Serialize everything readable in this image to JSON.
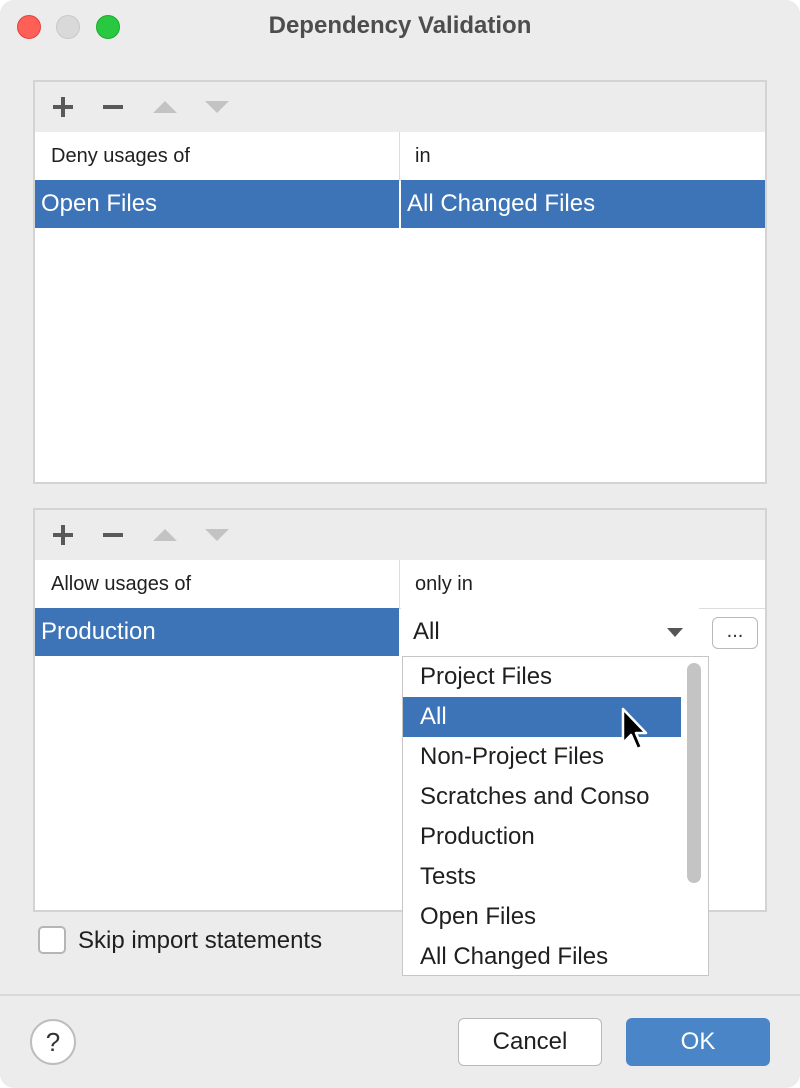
{
  "window": {
    "title": "Dependency Validation"
  },
  "deny_table": {
    "columns": [
      "Deny usages of",
      "in"
    ],
    "rows": [
      {
        "scope": "Open Files",
        "in": "All Changed Files"
      }
    ]
  },
  "allow_table": {
    "columns": [
      "Allow usages of",
      "only in"
    ],
    "rows": [
      {
        "scope": "Production",
        "only_in": "All"
      }
    ],
    "browse_label": "..."
  },
  "dropdown": {
    "options": [
      "Project Files",
      "All",
      "Non-Project Files",
      "Scratches and Conso",
      "Production",
      "Tests",
      "Open Files",
      "All Changed Files"
    ],
    "selected": "All"
  },
  "options": {
    "skip_imports_label": "Skip import statements",
    "skip_imports_checked": false
  },
  "footer": {
    "help_label": "?",
    "cancel_label": "Cancel",
    "ok_label": "OK"
  },
  "colors": {
    "selection": "#3d74b8",
    "ok_button": "#4a85c8",
    "window_bg": "#ececec"
  }
}
